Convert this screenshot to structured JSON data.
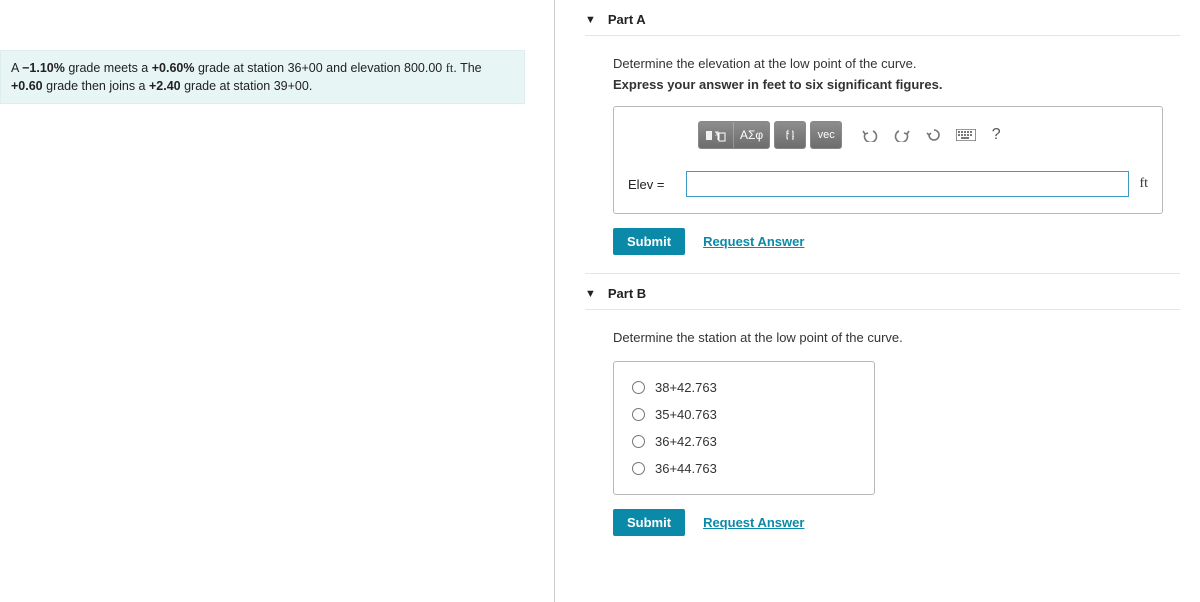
{
  "problem": {
    "html": "A <b>&minus;1.10%</b> grade meets a <b>+0.60%</b> grade at station 36+00 and elevation 800.00 <span class='rm'>ft</span>. The <b>+0.60</b> grade then joins a <b>+2.40</b> grade at station 39+00."
  },
  "partA": {
    "title": "Part A",
    "prompt": "Determine the elevation at the low point of the curve.",
    "instruction": "Express your answer in feet to six significant figures.",
    "label": "Elev =",
    "value": "",
    "unit": "ft",
    "symbols_label": "ΑΣφ",
    "vec_label": "vec",
    "help_label": "?",
    "submit": "Submit",
    "request": "Request Answer"
  },
  "partB": {
    "title": "Part B",
    "prompt": "Determine the station at the low point of the curve.",
    "options": [
      "38+42.763",
      "35+40.763",
      "36+42.763",
      "36+44.763"
    ],
    "submit": "Submit",
    "request": "Request Answer"
  }
}
